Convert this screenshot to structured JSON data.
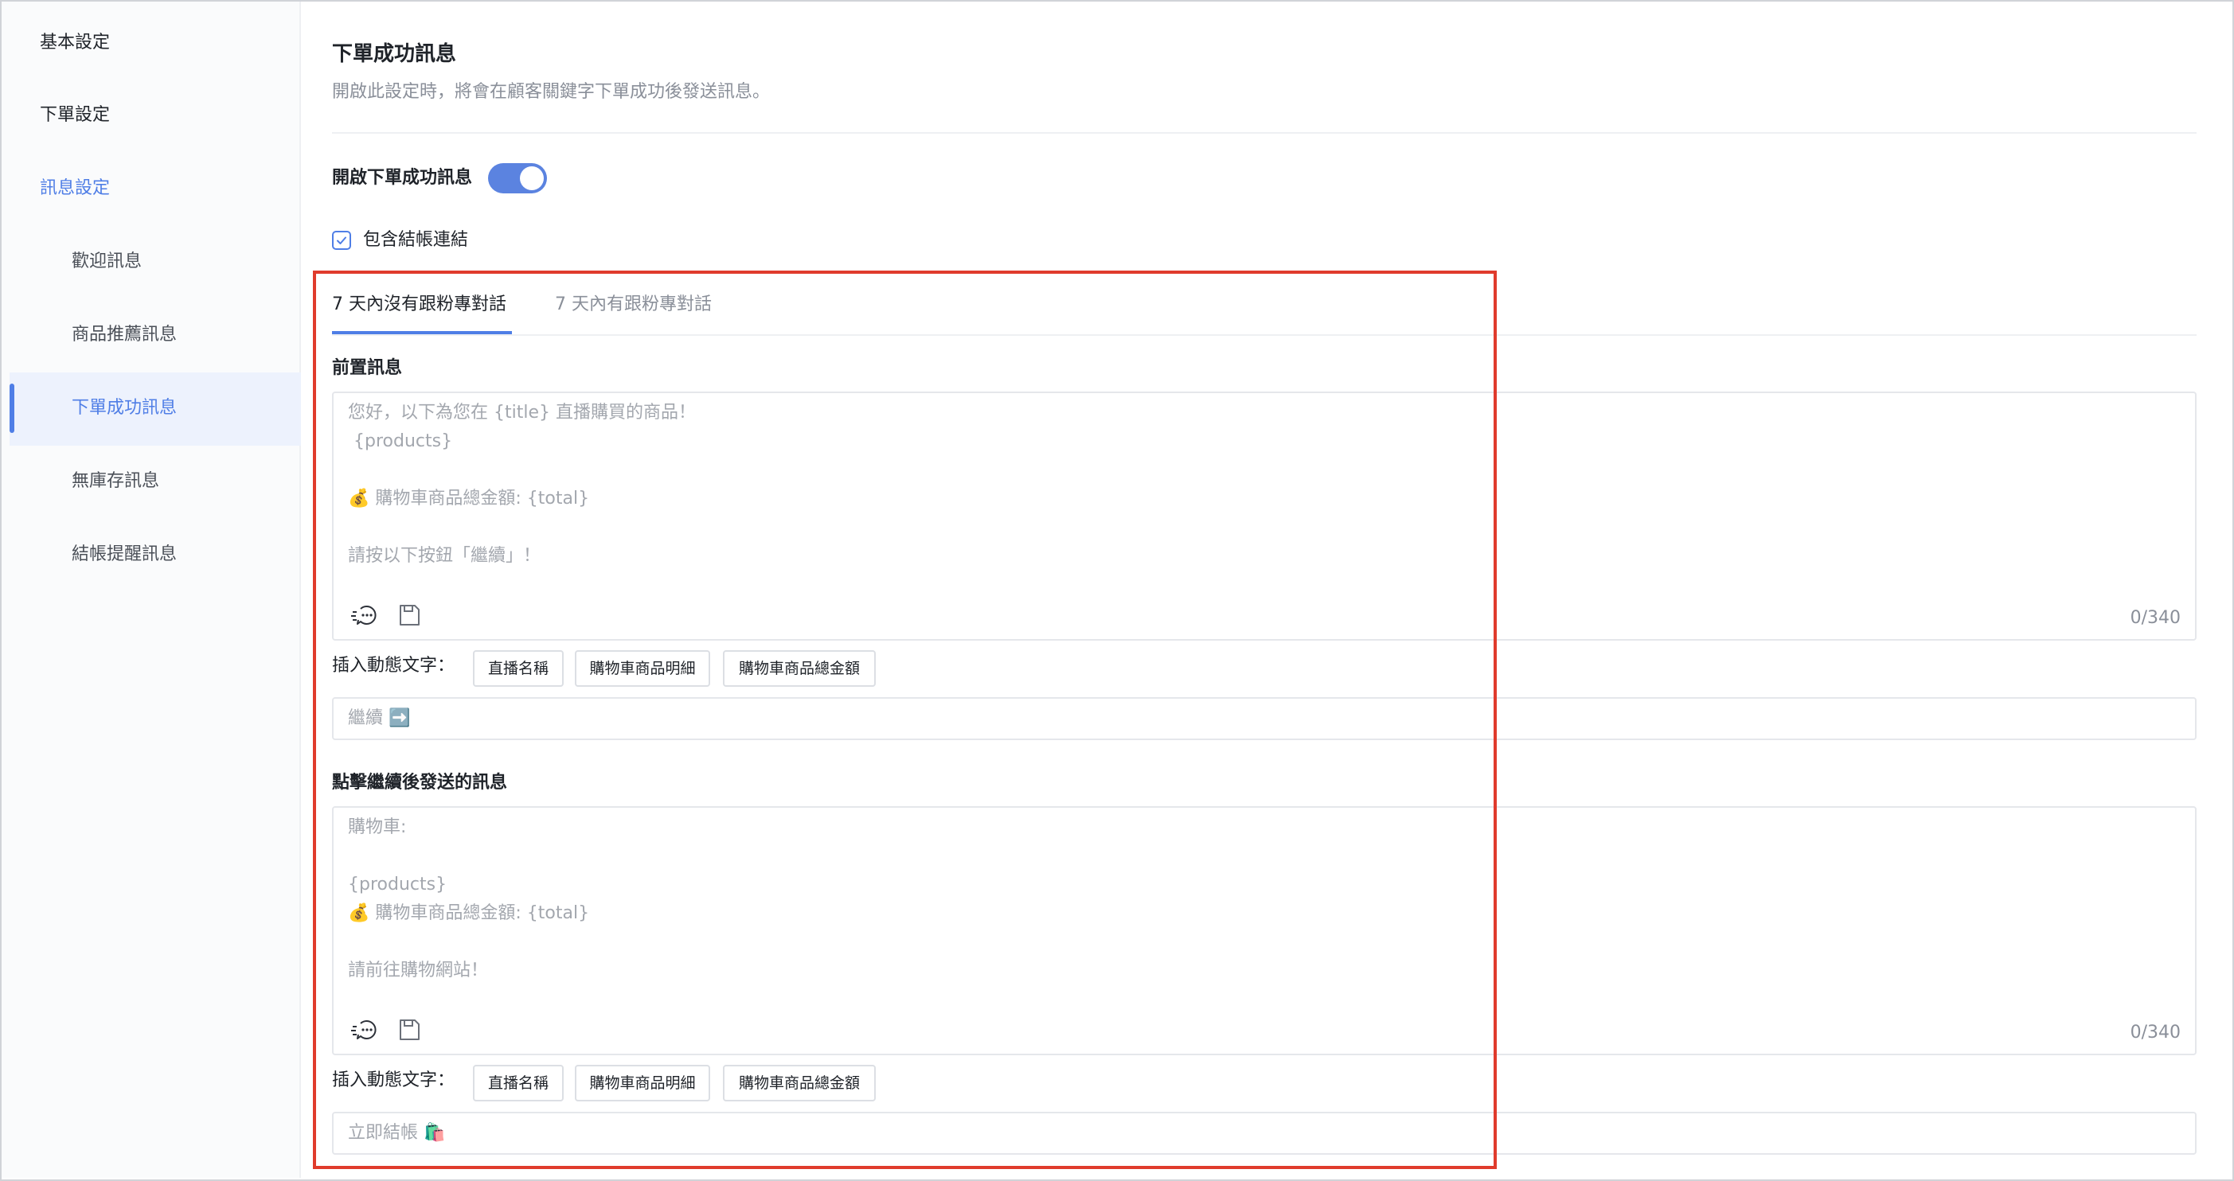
{
  "sidebar": {
    "items": [
      {
        "label": "基本設定"
      },
      {
        "label": "下單設定"
      },
      {
        "label": "訊息設定"
      },
      {
        "label": "歡迎訊息"
      },
      {
        "label": "商品推薦訊息"
      },
      {
        "label": "下單成功訊息"
      },
      {
        "label": "無庫存訊息"
      },
      {
        "label": "結帳提醒訊息"
      }
    ]
  },
  "header": {
    "title": "下單成功訊息",
    "description": "開啟此設定時，將會在顧客關鍵字下單成功後發送訊息。"
  },
  "toggle": {
    "label": "開啟下單成功訊息",
    "state": "on"
  },
  "checkbox": {
    "label": "包含結帳連結",
    "checked": true
  },
  "tabs": [
    {
      "label": "7 天內沒有跟粉專對話",
      "active": true
    },
    {
      "label": "7 天內有跟粉專對話",
      "active": false
    }
  ],
  "pre_message": {
    "label": "前置訊息",
    "placeholder_lines": [
      "您好，以下為您在 {title} 直播購買的商品！",
      " {products}",
      "",
      "💰 購物車商品總金額: {total}",
      "",
      "請按以下按鈕「繼續」！"
    ],
    "counter": "0/340",
    "insert_label": "插入動態文字：",
    "chips": [
      "直播名稱",
      "購物車商品明細",
      "購物車商品總金額"
    ],
    "button_placeholder": "繼續 ➡️"
  },
  "after_message": {
    "label": "點擊繼續後發送的訊息",
    "placeholder_lines": [
      "購物車:",
      "",
      "{products}",
      "💰 購物車商品總金額: {total}",
      "",
      "請前往購物網站！"
    ],
    "counter": "0/340",
    "insert_label": "插入動態文字：",
    "chips": [
      "直播名稱",
      "購物車商品明細",
      "購物車商品總金額"
    ],
    "button_placeholder": "立即結帳 🛍️"
  },
  "colors": {
    "accent": "#4f7ee6",
    "highlight_border": "#e03b2c"
  }
}
